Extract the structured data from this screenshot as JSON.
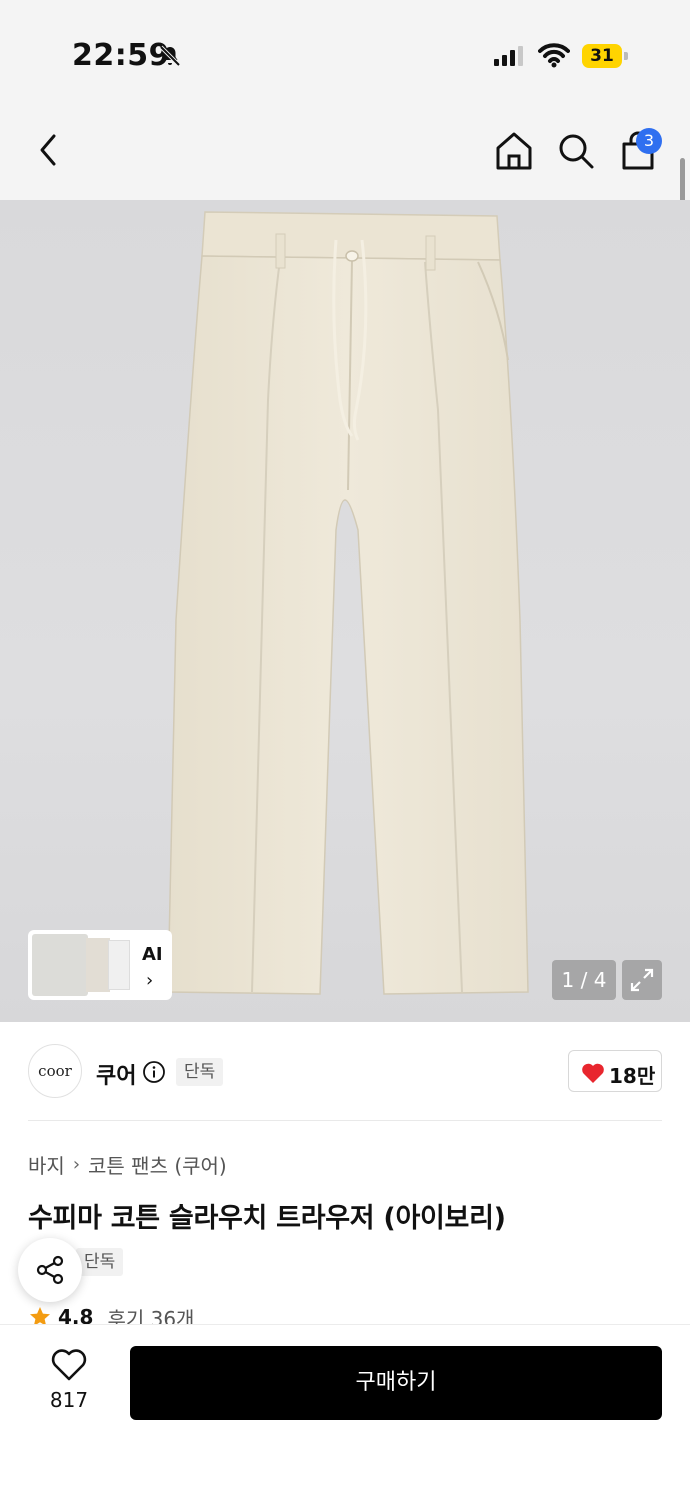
{
  "status_bar": {
    "time": "22:59",
    "battery": "31",
    "icons": [
      "bell-slash-icon",
      "signal-icon",
      "wifi-icon",
      "battery-icon"
    ]
  },
  "nav": {
    "icons": [
      "back-chevron-icon",
      "home-icon",
      "search-icon",
      "shopping-bag-icon"
    ],
    "cart_count": "3"
  },
  "gallery": {
    "image_counter": "1 / 4",
    "ai_label": "AI",
    "ai_chevron": "›",
    "product_color": "#ece6d6"
  },
  "brand": {
    "logo_text": "coor",
    "name": "쿠어",
    "exclusive_badge": "단독",
    "like_count": "18만",
    "heart_color": "#e8262e"
  },
  "product": {
    "breadcrumb": [
      "바지",
      "코튼 팬츠 (쿠어)"
    ],
    "breadcrumb_separator": "›",
    "title": "수피마 코튼 슬라우치 트라우저 (아이보리)",
    "tag": "단독",
    "rating": "4.8",
    "reviews": "후기 36개",
    "star_color": "#f39c12"
  },
  "bottom": {
    "wish_count": "817",
    "buy_label": "구매하기"
  }
}
